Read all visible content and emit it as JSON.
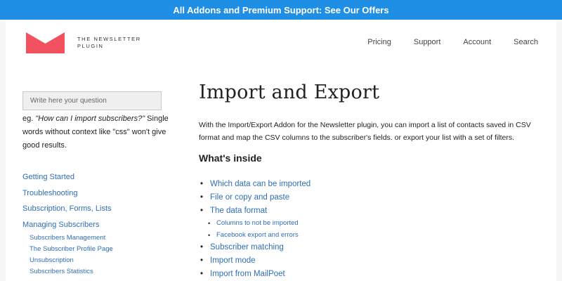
{
  "promo": {
    "text": "All Addons and Premium Support: See Our Offers"
  },
  "logo": {
    "text": "THE NEWSLETTER PLUGIN",
    "color": "#f2525f"
  },
  "nav": {
    "pricing": "Pricing",
    "support": "Support",
    "account": "Account",
    "search": "Search"
  },
  "search": {
    "placeholder": "Write here your question"
  },
  "hint": {
    "prefix": "eg. ",
    "example": "\"How can I import subscribers?\"",
    "suffix": " Single words without context like \"css\" won't give good results."
  },
  "sidebar": {
    "items": [
      {
        "label": "Getting Started"
      },
      {
        "label": "Troubleshooting"
      },
      {
        "label": "Subscription, Forms, Lists"
      },
      {
        "label": "Managing Subscribers"
      }
    ],
    "subitems": [
      {
        "label": "Subscribers Management"
      },
      {
        "label": "The Subscriber Profile Page"
      },
      {
        "label": "Unsubscription"
      },
      {
        "label": "Subscribers Statistics"
      }
    ]
  },
  "article": {
    "title": "Import and Export",
    "intro": "With the Import/Export Addon for the Newsletter plugin, you can import a list of contacts saved in CSV format and map the CSV columns to the subscriber's fields. or export your list with a set of filters.",
    "toc_heading": "What's inside",
    "toc": [
      {
        "label": "Which data can be imported",
        "level": 1
      },
      {
        "label": "File or copy and paste",
        "level": 1
      },
      {
        "label": "The data format",
        "level": 1
      },
      {
        "label": "Columns to not be imported",
        "level": 2
      },
      {
        "label": "Facebook export and errors",
        "level": 2
      },
      {
        "label": "Subscriber matching",
        "level": 1
      },
      {
        "label": "Import mode",
        "level": 1
      },
      {
        "label": "Import from MailPoet",
        "level": 1
      }
    ]
  },
  "colors": {
    "promo_bar": "#1f8fe6",
    "link": "#2f6eb3",
    "page_bg": "#f7f7f7"
  }
}
